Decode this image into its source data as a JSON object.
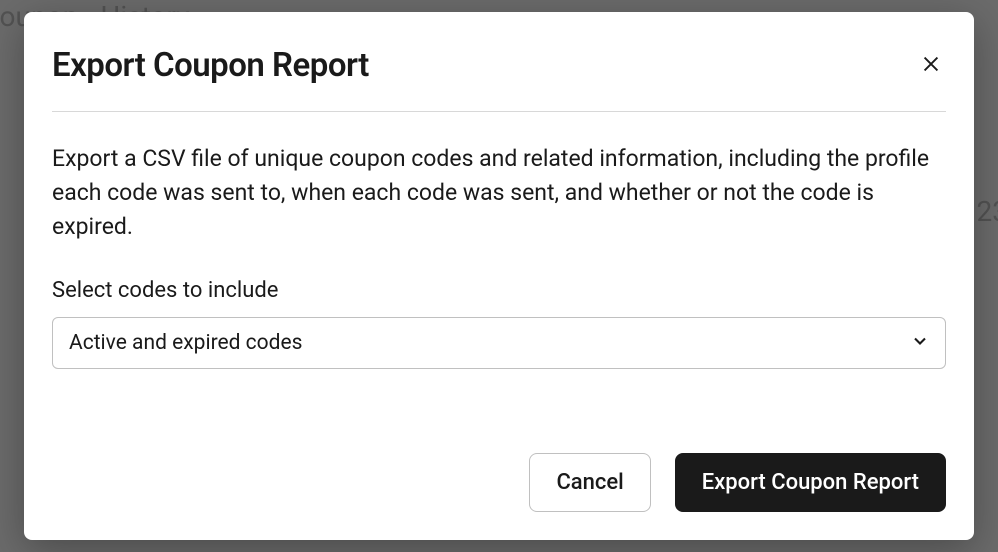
{
  "background": {
    "breadcrumb": "ecoupon  ›  History",
    "right_fragment": "23"
  },
  "modal": {
    "title": "Export Coupon Report",
    "description": "Export a CSV file of unique coupon codes and related information, including the profile each code was sent to, when each code was sent, and whether or not the code is expired.",
    "field_label": "Select codes to include",
    "select_value": "Active and expired codes",
    "cancel_label": "Cancel",
    "export_label": "Export Coupon Report"
  }
}
